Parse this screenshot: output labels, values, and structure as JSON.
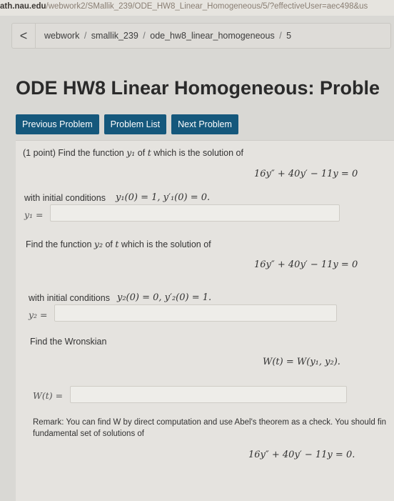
{
  "browser": {
    "url_host": "ath.nau.edu",
    "url_path": "/webwork2/SMallik_239/ODE_HW8_Linear_Homogeneous/5/?effectiveUser=aec498&us"
  },
  "breadcrumb": {
    "back_symbol": "<",
    "items": [
      "webwork",
      "smallik_239",
      "ode_hw8_linear_homogeneous",
      "5"
    ],
    "separator": "/"
  },
  "page_title": "ODE HW8 Linear Homogeneous: Proble",
  "nav": {
    "previous": "Previous Problem",
    "list": "Problem List",
    "next": "Next Problem"
  },
  "problem": {
    "part1_prompt_a": "(1 point) Find the function ",
    "part1_var": "y₁",
    "part1_prompt_b": " of ",
    "part1_t": "t",
    "part1_prompt_c": " which is the solution of",
    "equation1": "16y″ + 40y′ − 11y = 0",
    "initial1_label": "with initial conditions",
    "initial1_math": "y₁(0) = 1,   y′₁(0) = 0.",
    "answer1_label": "y₁ =",
    "answer1_value": "",
    "part2_prompt_a": "Find the function ",
    "part2_var": "y₂",
    "part2_prompt_b": " of ",
    "part2_t": "t",
    "part2_prompt_c": " which is the solution of",
    "equation2": "16y″ + 40y′ − 11y = 0",
    "initial2_label": "with initial conditions",
    "initial2_math": "y₂(0) = 0,   y′₂(0) = 1.",
    "answer2_label": "y₂ =",
    "answer2_value": "",
    "wronskian_prompt": "Find the Wronskian",
    "wronskian_def": "W(t) = W(y₁, y₂).",
    "answer3_label": "W(t) =",
    "answer3_value": "",
    "remark_line1": "Remark: You can find W by direct computation and use Abel's theorem as a check. You should fin",
    "remark_line2": "fundamental set of solutions of",
    "equation3": "16y″ + 40y′ − 11y = 0."
  }
}
